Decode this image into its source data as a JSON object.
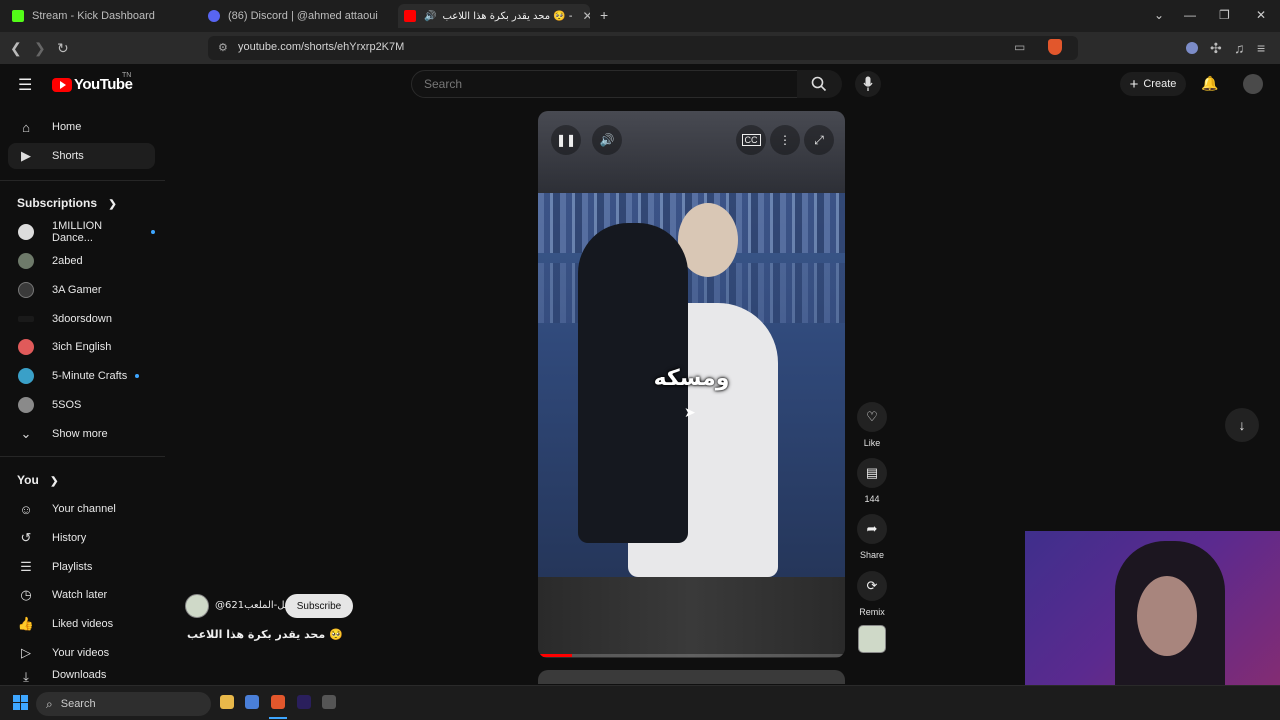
{
  "browser": {
    "tabs": [
      {
        "title": "Stream - Kick Dashboard",
        "favicon_color": "#53fc18"
      },
      {
        "title": "(86) Discord | @ahmed attaoui",
        "favicon_color": "#5865f2"
      },
      {
        "title": "محد يقدر بكرة هذا اللاعب 🥺 -",
        "favicon_color": "#ff0000"
      }
    ],
    "new_tab": "+",
    "url": "youtube.com/shorts/ehYrxrp2K7M"
  },
  "youtube": {
    "logo_text": "YouTube",
    "logo_tm": "TN",
    "search_placeholder": "Search",
    "create_label": "Create"
  },
  "sidebar": {
    "main": [
      {
        "label": "Home",
        "icon": "home-icon"
      },
      {
        "label": "Shorts",
        "icon": "shorts-icon"
      }
    ],
    "subscriptions_title": "Subscriptions",
    "subscriptions": [
      {
        "label": "1MILLION Dance...",
        "color": "#dcdcdc",
        "new": true
      },
      {
        "label": "2abed",
        "color": "#6e7a6a",
        "new": false
      },
      {
        "label": "3A Gamer",
        "color": "#3a3a3a",
        "new": false
      },
      {
        "label": "3doorsdown",
        "color": "#1a1a1a",
        "new": false
      },
      {
        "label": "3ich English",
        "color": "#e05a5a",
        "new": false
      },
      {
        "label": "5-Minute Crafts",
        "color": "#3aa0c8",
        "new": true
      },
      {
        "label": "5SOS",
        "color": "#8a8a8a",
        "new": false
      }
    ],
    "show_more": "Show more",
    "you_title": "You",
    "you_items": [
      {
        "label": "Your channel",
        "icon": "channel-icon"
      },
      {
        "label": "History",
        "icon": "history-icon"
      },
      {
        "label": "Playlists",
        "icon": "playlists-icon"
      },
      {
        "label": "Watch later",
        "icon": "clock-icon"
      },
      {
        "label": "Liked videos",
        "icon": "like-icon"
      },
      {
        "label": "Your videos",
        "icon": "video-icon"
      },
      {
        "label": "Downloads",
        "icon": "download-icon"
      }
    ]
  },
  "short": {
    "caption": "ومسكه",
    "channel": "@عقل-الملعب621",
    "subscribe": "Subscribe",
    "title": "محد يقدر بكرة هذا اللاعب 🥺",
    "progress_fraction": 0.11,
    "actions": [
      {
        "label": "Like",
        "icon": "heart-icon"
      },
      {
        "label": "144",
        "icon": "comment-icon"
      },
      {
        "label": "Share",
        "icon": "share-icon"
      },
      {
        "label": "Remix",
        "icon": "remix-icon"
      }
    ]
  },
  "taskbar": {
    "search_placeholder": "Search"
  }
}
